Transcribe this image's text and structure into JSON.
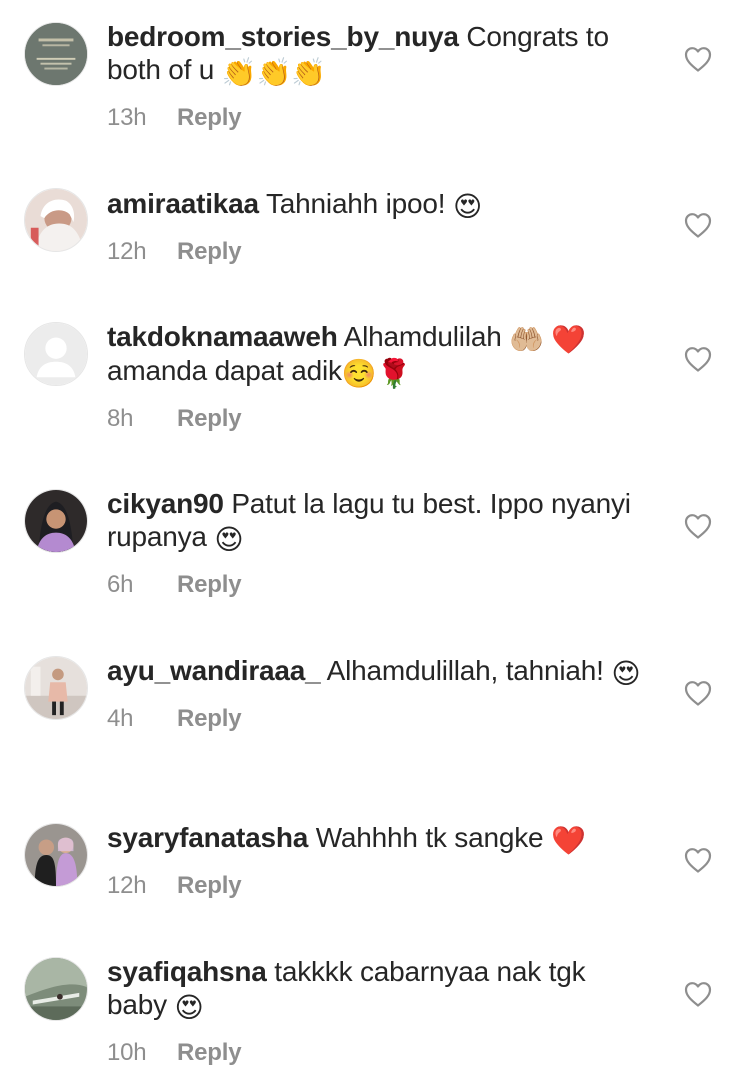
{
  "comments": [
    {
      "username": "bedroom_stories_by_nuya",
      "text": "Congrats to both of u",
      "emoji": "👏👏👏",
      "time": "13h",
      "reply": "Reply",
      "avatar": "logo-avatar"
    },
    {
      "username": "amiraatikaa",
      "text": "Tahniahh ipoo!",
      "emoji": "😍",
      "time": "12h",
      "reply": "Reply",
      "avatar": "photo-avatar"
    },
    {
      "username": "takdoknamaaweh",
      "text": "Alhamdulilah",
      "emoji": "🤲🏼 ❤️",
      "text2": "amanda dapat adik",
      "emoji2": "☺️🌹",
      "time": "8h",
      "reply": "Reply",
      "avatar": "default-avatar"
    },
    {
      "username": "cikyan90",
      "text": "Patut la lagu tu best. Ippo nyanyi rupanya",
      "emoji": "😍",
      "time": "6h",
      "reply": "Reply",
      "avatar": "photo-avatar"
    },
    {
      "username": "ayu_wandiraaa_",
      "text": "Alhamdulillah, tahniah!",
      "emoji": "😍",
      "time": "4h",
      "reply": "Reply",
      "avatar": "photo-avatar"
    },
    {
      "username": "syaryfanatasha",
      "text": "Wahhhh tk sangke",
      "emoji": "❤️",
      "time": "12h",
      "reply": "Reply",
      "avatar": "photo-avatar"
    },
    {
      "username": "syafiqahsna",
      "text": "takkkk cabarnyaa nak tgk baby",
      "emoji": "😍",
      "time": "10h",
      "reply": "Reply",
      "avatar": "photo-avatar"
    }
  ],
  "icons": {
    "like": "heart-outline-icon"
  },
  "colors": {
    "text": "#262626",
    "meta": "#8e8e8e",
    "background": "#ffffff"
  }
}
